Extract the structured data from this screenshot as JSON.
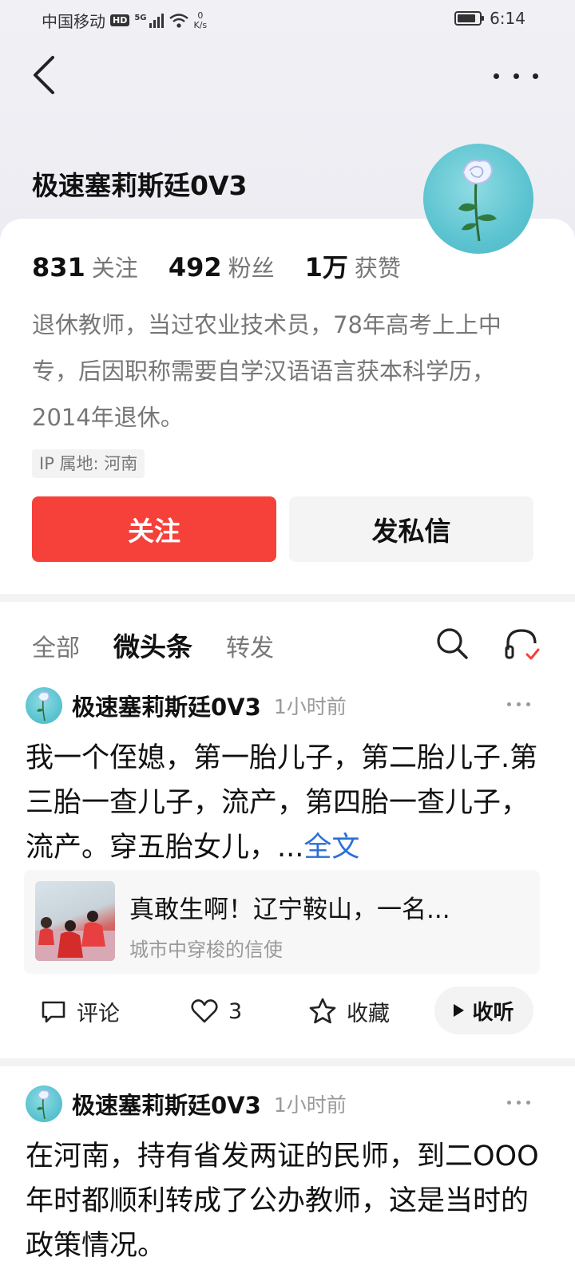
{
  "status_bar": {
    "carrier": "中国移动",
    "hd": "HD",
    "network": "5G",
    "speed_value": "0",
    "speed_unit": "K/s",
    "time": "6:14"
  },
  "profile": {
    "name": "极速塞莉斯廷0V3",
    "stats": [
      {
        "num": "831",
        "label": "关注"
      },
      {
        "num": "492",
        "label": "粉丝"
      },
      {
        "num": "1万",
        "label": "获赞"
      }
    ],
    "bio": "退休教师，当过农业技术员，78年高考上上中专，后因职称需要自学汉语语言获本科学历，2014年退休。",
    "ip": "IP 属地: 河南",
    "follow_label": "关注",
    "message_label": "发私信"
  },
  "tabs": [
    {
      "label": "全部",
      "active": false
    },
    {
      "label": "微头条",
      "active": true
    },
    {
      "label": "转发",
      "active": false
    }
  ],
  "posts": [
    {
      "author": "极速塞莉斯廷0V3",
      "time": "1小时前",
      "text": "我一个侄媳，第一胎儿子，第二胎儿子.第三胎一查儿子，流产，第四胎一查儿子，流产。穿五胎女儿，...",
      "full_label": "全文",
      "quote": {
        "title": "真敢生啊！辽宁鞍山，一名...",
        "source": "城市中穿梭的信使"
      },
      "actions": {
        "comment": "评论",
        "like_count": "3",
        "favorite": "收藏",
        "listen": "收听"
      }
    },
    {
      "author": "极速塞莉斯廷0V3",
      "time": "1小时前",
      "text": "在河南，持有省发两证的民师，到二OOO年时都顺利转成了公办教师，这是当时的政策情况。"
    }
  ],
  "colors": {
    "accent": "#f5413a",
    "link": "#2a6fd6"
  }
}
